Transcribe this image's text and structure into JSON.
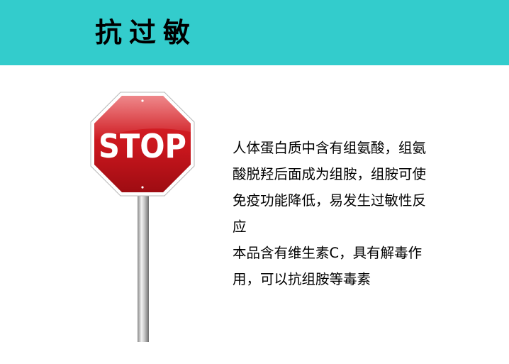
{
  "title": "抗过敏",
  "stop_sign": {
    "text": "STOP",
    "color": "#c8161d",
    "icon": "stop-sign-icon"
  },
  "paragraphs": [
    "人体蛋白质中含有组氨酸，组氨酸脱羟后面成为组胺，组胺可使免疫功能降低，易发生过敏性反应",
    "本品含有维生素C，具有解毒作用，可以抗组胺等毒素"
  ],
  "colors": {
    "header": "#33cccc",
    "background": "#ffffff",
    "text": "#000000"
  }
}
